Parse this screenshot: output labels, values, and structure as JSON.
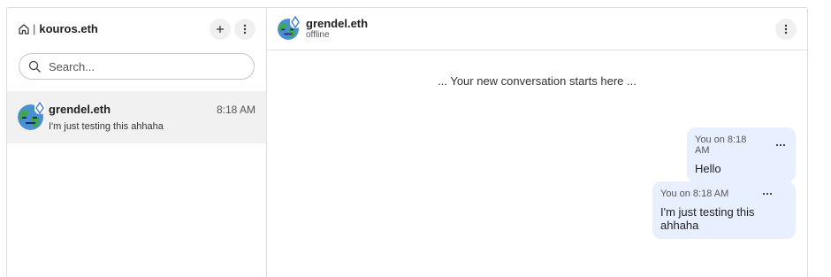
{
  "sidebar": {
    "account_name": "kouros.eth",
    "separator": "|",
    "search_placeholder": "Search...",
    "conversations": [
      {
        "name": "grendel.eth",
        "time": "8:18 AM",
        "preview": "I'm just testing this ahhaha"
      }
    ]
  },
  "chat": {
    "peer_name": "grendel.eth",
    "peer_status": "offline",
    "conversation_start": "... Your new conversation starts here ...",
    "messages": [
      {
        "meta": "You on 8:18 AM",
        "text": "Hello"
      },
      {
        "meta": "You on 8:18 AM",
        "text": "I'm just testing this ahhaha"
      }
    ]
  },
  "colors": {
    "bubble": "#e8efff",
    "selected_row": "#f1f1f1",
    "button_bg": "#f0f0f0"
  },
  "icons": [
    "home-icon",
    "plus-icon",
    "kebab-menu-icon",
    "search-icon",
    "ethereum-icon",
    "ellipsis-icon"
  ]
}
